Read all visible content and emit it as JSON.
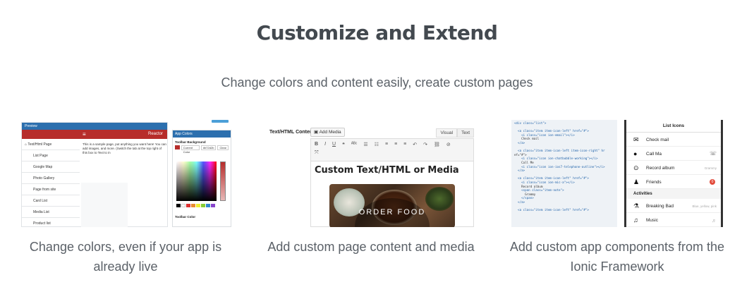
{
  "section": {
    "title": "Customize and Extend",
    "subtitle": "Change colors and content easily, create custom pages"
  },
  "features": [
    {
      "caption": "Change colors, even if your app is already live",
      "preview": {
        "window_label": "Preview",
        "brand": "Reactor",
        "menu": [
          "Text/Html Page",
          "List Page",
          "Google Map",
          "Photo Gallery",
          "Page from site",
          "Card List",
          "Media List",
          "Product list"
        ],
        "body_text": "This is a sample page, put anything you want here! You can add images, and more. (Switch the tab at the top right of this box to Text to in"
      },
      "app_colors": {
        "title": "App Colors",
        "toolbar_background_label": "Toolbar Background",
        "current_color_label": "Current Color",
        "hex_value": "#b72d2b",
        "clear_label": "Clear",
        "toolbar_color_label": "Toolbar Color",
        "accent": "#b72d2b",
        "header_color": "#2c6fae"
      }
    },
    {
      "caption": "Add custom page content and media",
      "editor": {
        "field_label": "Text/HTML Content",
        "add_media_label": "Add Media",
        "tabs": [
          "Visual",
          "Text"
        ],
        "toolbar_icons": [
          "bold-icon",
          "italic-icon",
          "underline-icon",
          "quote-icon",
          "strikethrough-icon",
          "bullet-list-icon",
          "numbered-list-icon",
          "align-left-icon",
          "align-center-icon",
          "align-right-icon",
          "undo-icon",
          "redo-icon",
          "link-icon",
          "unlink-icon",
          "fullscreen-icon"
        ],
        "heading": "Custom Text/HTML or Media",
        "image_text": "ORDER FOOD"
      }
    },
    {
      "caption": "Add custom app components from the Ionic Framework",
      "code_lines": [
        "<div class=\"list\">",
        "",
        "  <a class=\"item item-icon-left\" href=\"#\">",
        "    <i class=\"icon ion-email\"></i>",
        "    Check mail",
        "  </a>",
        "",
        "  <a class=\"item item-icon-left item-icon-right\" hr",
        "ef=\"#\">",
        "    <i class=\"icon ion-chatbubble-working\"></i>",
        "    Call Me",
        "    <i class=\"icon ion-ios7-telephone-outline\"></i>",
        "  </a>",
        "",
        "  <a class=\"item item-icon-left\" href=\"#\">",
        "    <i class=\"icon ion-mic-a\"></i>",
        "    Record album",
        "    <span class=\"item-note\">",
        "      Grammy",
        "    </span>",
        "  </a>",
        "",
        "  <a class=\"item item-icon-left\" href=\"#\">"
      ],
      "list": {
        "title": "List Icons",
        "items": [
          {
            "label": "Check mail",
            "icon": "mail-icon",
            "glyph": "✉",
            "note": ""
          },
          {
            "label": "Call Ma",
            "icon": "chat-icon",
            "glyph": "●",
            "note": "☏"
          },
          {
            "label": "Record album",
            "icon": "mic-icon",
            "glyph": "🎙",
            "note": "Grammy"
          },
          {
            "label": "Friends",
            "icon": "people-icon",
            "glyph": "👥",
            "badge": "0"
          }
        ],
        "divider": "Activities",
        "items2": [
          {
            "label": "Breaking Bad",
            "icon": "flask-icon",
            "glyph": "⚗",
            "note": "Blue, yellow, pink"
          },
          {
            "label": "Music",
            "icon": "music-icon",
            "glyph": "♫",
            "note": "♬"
          }
        ]
      }
    }
  ]
}
